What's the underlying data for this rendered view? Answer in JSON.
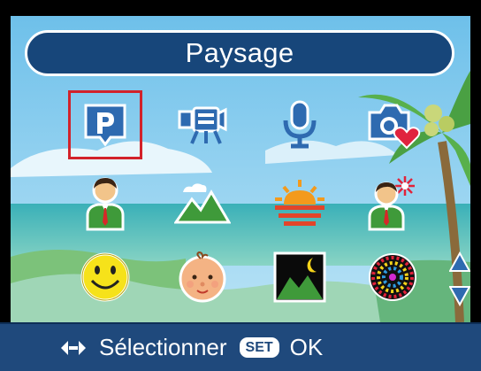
{
  "header": {
    "title": "Paysage"
  },
  "scene_modes": [
    {
      "icon": "program-mode-icon",
      "selected": true
    },
    {
      "icon": "video-camera-icon",
      "selected": false
    },
    {
      "icon": "microphone-icon",
      "selected": false
    },
    {
      "icon": "camera-heart-icon",
      "selected": false
    },
    {
      "icon": "portrait-icon",
      "selected": false
    },
    {
      "icon": "landscape-icon",
      "selected": false
    },
    {
      "icon": "sunset-icon",
      "selected": false
    },
    {
      "icon": "night-portrait-icon",
      "selected": false
    },
    {
      "icon": "smile-icon",
      "selected": false
    },
    {
      "icon": "baby-icon",
      "selected": false
    },
    {
      "icon": "night-landscape-icon",
      "selected": false
    },
    {
      "icon": "fireworks-icon",
      "selected": false
    }
  ],
  "footer": {
    "nav_hint": "Sélectionner",
    "set_badge": "SET",
    "ok_label": "OK"
  },
  "colors": {
    "title_bar": "#17467a",
    "footer": "#1f497c",
    "selection": "#d2222a"
  }
}
